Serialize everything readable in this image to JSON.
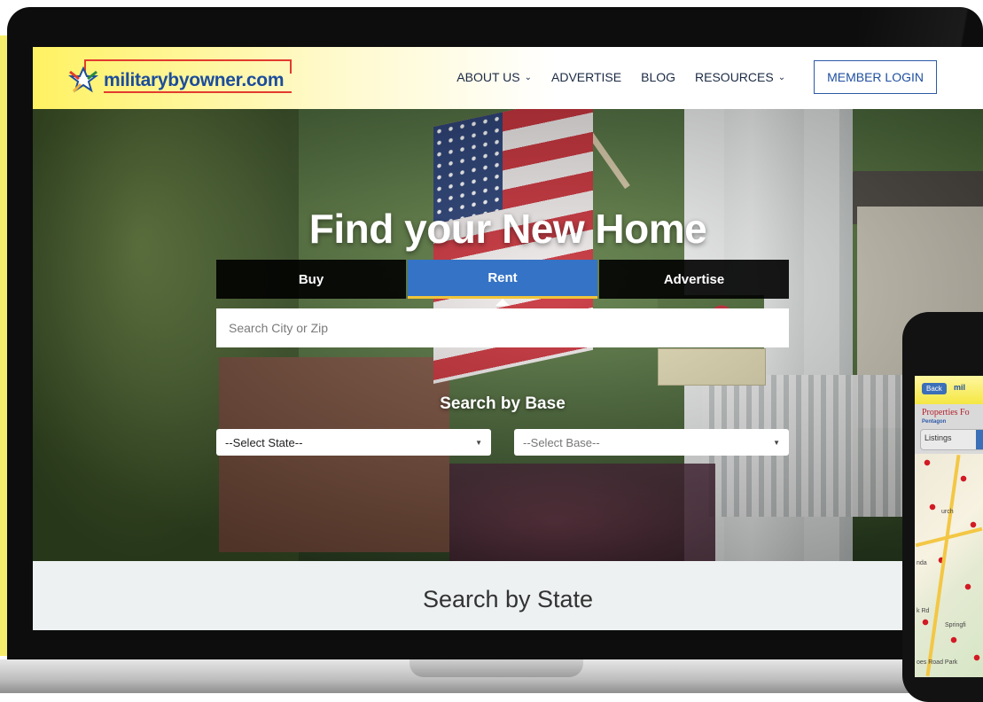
{
  "site": {
    "logo_text": "militarybyowner.com",
    "nav": {
      "about": "ABOUT US",
      "advertise": "ADVERTISE",
      "blog": "BLOG",
      "resources": "RESOURCES",
      "login": "MEMBER LOGIN"
    }
  },
  "hero": {
    "title": "Find your New Home",
    "tabs": [
      {
        "label": "Buy",
        "active": false
      },
      {
        "label": "Rent",
        "active": true
      },
      {
        "label": "Advertise",
        "active": false
      }
    ],
    "search_placeholder": "Search City or Zip",
    "base_heading": "Search by Base",
    "state_select": "--Select State--",
    "base_select": "--Select Base--"
  },
  "section": {
    "state_heading": "Search by State"
  },
  "phone": {
    "back": "Back",
    "logo": "mil",
    "title": "Properties Fo",
    "subtitle": "Pentagon",
    "tab_listings": "Listings",
    "map_labels": [
      "urch",
      "nda",
      "k Rd",
      "Springfi",
      "oes Road Park"
    ]
  },
  "colors": {
    "brand_blue": "#1c4d9c",
    "active_tab": "#3473c6",
    "header_yellow": "#fff262",
    "pin_red": "#d21a24"
  }
}
